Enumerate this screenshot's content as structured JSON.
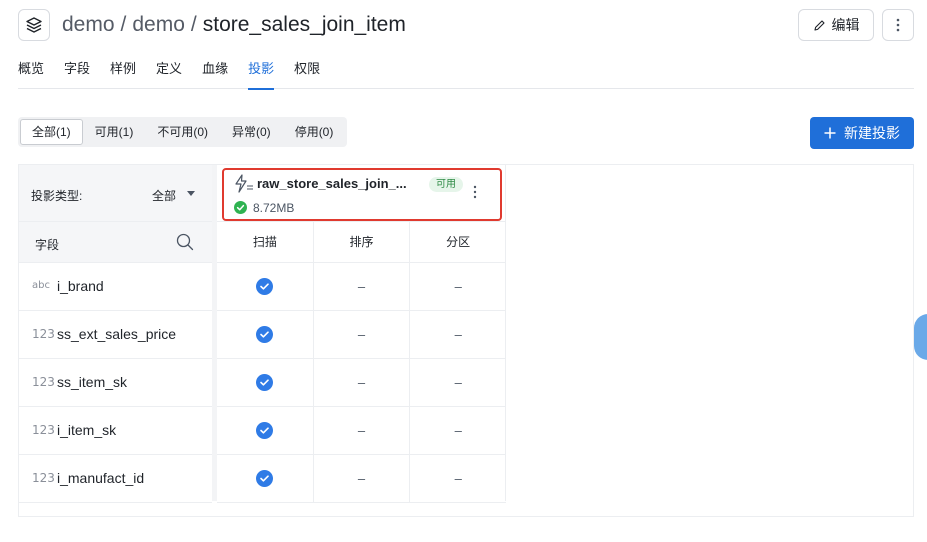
{
  "header": {
    "crumb1": "demo",
    "crumb2": "demo",
    "current": "store_sales_join_item",
    "sep": "/",
    "edit_label": "编辑"
  },
  "tabs": [
    {
      "label": "概览"
    },
    {
      "label": "字段"
    },
    {
      "label": "样例"
    },
    {
      "label": "定义"
    },
    {
      "label": "血缘"
    },
    {
      "label": "投影",
      "active": true
    },
    {
      "label": "权限"
    }
  ],
  "filters": [
    {
      "label": "全部(1)",
      "active": true
    },
    {
      "label": "可用(1)"
    },
    {
      "label": "不可用(0)"
    },
    {
      "label": "异常(0)"
    },
    {
      "label": "停用(0)"
    }
  ],
  "new_button": {
    "label": "新建投影"
  },
  "left": {
    "type_label": "投影类型:",
    "type_value": "全部",
    "field_label": "字段"
  },
  "fields": [
    {
      "type": "abc",
      "name": "i_brand"
    },
    {
      "type": "123",
      "name": "ss_ext_sales_price"
    },
    {
      "type": "123",
      "name": "ss_item_sk"
    },
    {
      "type": "123",
      "name": "i_item_sk"
    },
    {
      "type": "123",
      "name": "i_manufact_id"
    }
  ],
  "projection": {
    "name": "raw_store_sales_join_...",
    "status": "可用",
    "size": "8.72MB",
    "col_scan": "扫描",
    "col_sort": "排序",
    "col_partition": "分区",
    "dash": "–"
  },
  "colors": {
    "accent": "#1f6fd9",
    "highlight": "#e03a2f",
    "ok": "#2fb351"
  }
}
